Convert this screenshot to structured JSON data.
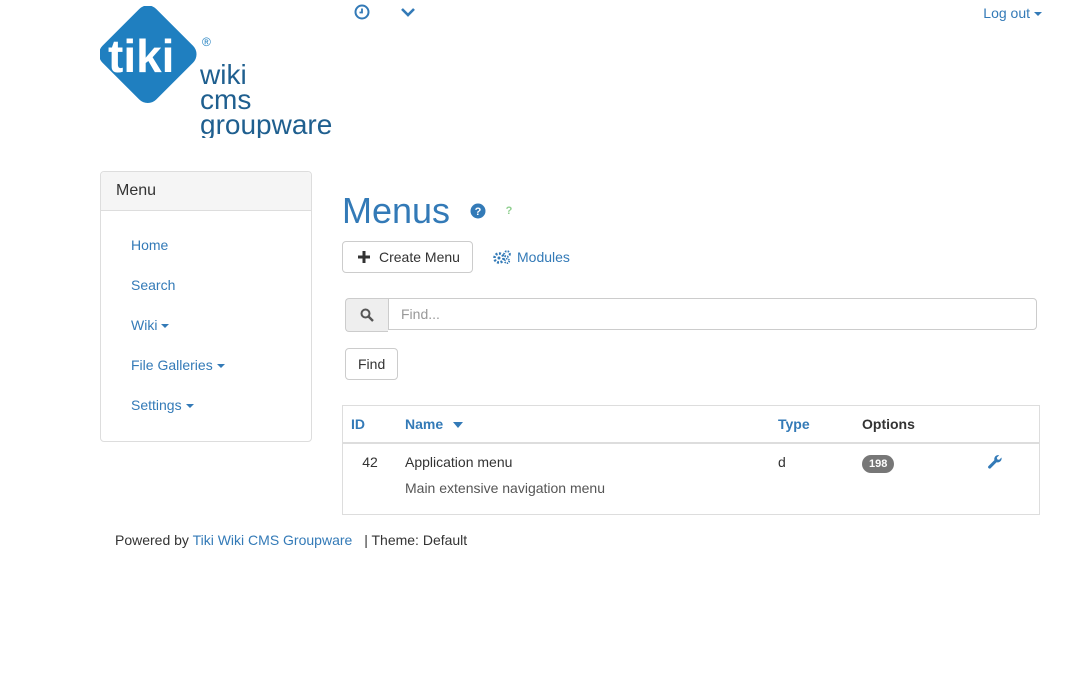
{
  "logo": {
    "brand": "tiki",
    "line1": "wiki",
    "line2": "cms",
    "line3": "groupware",
    "reg": "®"
  },
  "topbar": {
    "clock_icon": "clock-icon",
    "chevron_icon": "chevron-down-icon",
    "logout_label": "Log out"
  },
  "sidebar": {
    "title": "Menu",
    "items": [
      {
        "label": "Home",
        "dropdown": false
      },
      {
        "label": "Search",
        "dropdown": false
      },
      {
        "label": "Wiki",
        "dropdown": true
      },
      {
        "label": "File Galleries",
        "dropdown": true
      },
      {
        "label": "Settings",
        "dropdown": true
      }
    ]
  },
  "main": {
    "title": "Menus",
    "create_label": "Create Menu",
    "modules_label": "Modules",
    "search_placeholder": "Find...",
    "find_label": "Find",
    "table": {
      "headers": {
        "id": "ID",
        "name": "Name",
        "type": "Type",
        "options": "Options"
      },
      "rows": [
        {
          "id": "42",
          "name": "Application menu",
          "description": "Main extensive navigation menu",
          "type": "d",
          "options": "198"
        }
      ]
    }
  },
  "footer": {
    "powered": "Powered by",
    "link": "Tiki Wiki CMS Groupware",
    "theme": "| Theme: Default"
  },
  "colors": {
    "link": "#337ab7",
    "badge": "#777777",
    "logo_blue": "#1f7fc0"
  }
}
